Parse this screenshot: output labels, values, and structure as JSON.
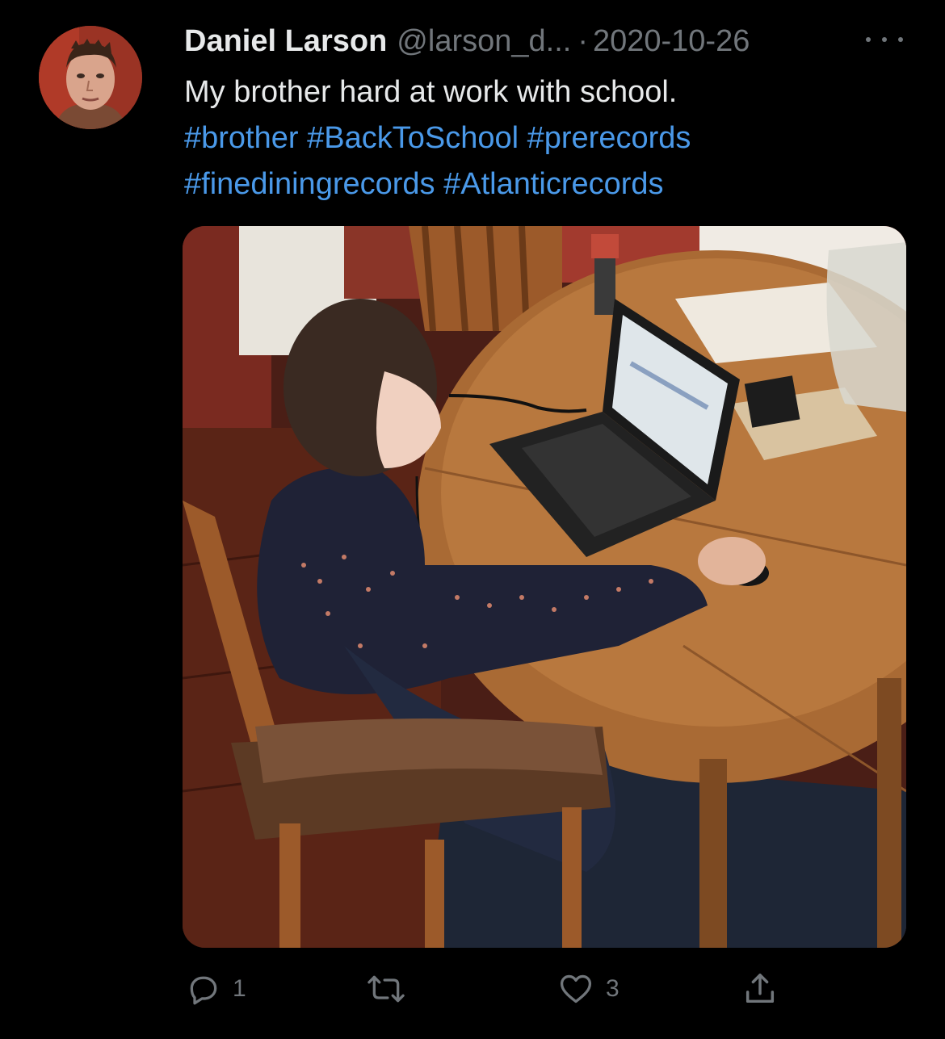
{
  "tweet": {
    "author": {
      "display_name": "Daniel Larson",
      "handle": "@larson_d...",
      "separator": "·",
      "date": "2020-10-26"
    },
    "text": "My brother hard at work with school.",
    "hashtags": [
      "#brother",
      "#BackToSchool",
      "#prerecords",
      "#finediningrecords",
      "#Atlanticrecords"
    ],
    "metrics": {
      "replies": "1",
      "retweets": "",
      "likes": "3"
    },
    "icons": {
      "reply": "reply-icon",
      "retweet": "retweet-icon",
      "like": "heart-icon",
      "share": "share-icon",
      "more": "more-icon"
    },
    "colors": {
      "background": "#000000",
      "text": "#e7e9ea",
      "secondary": "#71767b",
      "link": "#4a99e9"
    }
  }
}
